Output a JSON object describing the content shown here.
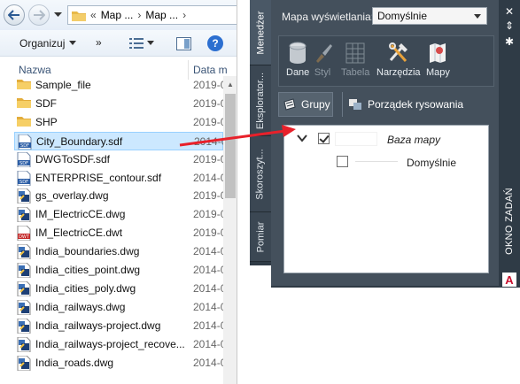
{
  "explorer": {
    "address": {
      "back_icon": "back-arrow-icon",
      "forward_icon": "forward-arrow-icon",
      "overflow": "«",
      "crumbs": [
        "Map ...",
        "Map ..."
      ],
      "crumb_separator": "›"
    },
    "toolbar": {
      "organize_label": "Organizuj",
      "more_label": "»",
      "help_label": "?"
    },
    "columns": {
      "name": "Nazwa",
      "date": "Data m"
    },
    "files": [
      {
        "name": "Sample_file",
        "date": "2019-0",
        "icon": "folder-icon"
      },
      {
        "name": "SDF",
        "date": "2019-0",
        "icon": "folder-icon"
      },
      {
        "name": "SHP",
        "date": "2019-0",
        "icon": "folder-icon"
      },
      {
        "name": "City_Boundary.sdf",
        "date": "2014-0",
        "icon": "sdf-file-icon",
        "selected": true
      },
      {
        "name": "DWGToSDF.sdf",
        "date": "2019-0",
        "icon": "sdf-file-icon"
      },
      {
        "name": "ENTERPRISE_contour.sdf",
        "date": "2014-0",
        "icon": "sdf-file-icon"
      },
      {
        "name": "gs_overlay.dwg",
        "date": "2019-0",
        "icon": "dwg-file-icon"
      },
      {
        "name": "IM_ElectricCE.dwg",
        "date": "2019-0",
        "icon": "dwg-file-icon"
      },
      {
        "name": "IM_ElectricCE.dwt",
        "date": "2019-0",
        "icon": "dwt-file-icon"
      },
      {
        "name": "India_boundaries.dwg",
        "date": "2014-0",
        "icon": "dwg-file-icon"
      },
      {
        "name": "India_cities_point.dwg",
        "date": "2014-0",
        "icon": "dwg-file-icon"
      },
      {
        "name": "India_cities_poly.dwg",
        "date": "2014-0",
        "icon": "dwg-file-icon"
      },
      {
        "name": "India_railways.dwg",
        "date": "2014-0",
        "icon": "dwg-file-icon"
      },
      {
        "name": "India_railways-project.dwg",
        "date": "2014-0",
        "icon": "dwg-file-icon"
      },
      {
        "name": "India_railways-project_recove...",
        "date": "2014-0",
        "icon": "dwg-file-icon"
      },
      {
        "name": "India_roads.dwg",
        "date": "2014-0",
        "icon": "dwg-file-icon"
      }
    ]
  },
  "palette": {
    "left_tabs": [
      "Menedżer",
      "Eksplorator...",
      "Skoroszyt...",
      "Pomiar"
    ],
    "map_label": "Mapa wyświetlania:",
    "map_value": "Domyślnie",
    "ribbon": [
      {
        "label": "Dane",
        "icon": "database-icon",
        "enabled": true
      },
      {
        "label": "Styl",
        "icon": "brush-icon",
        "enabled": false
      },
      {
        "label": "Tabela",
        "icon": "table-icon",
        "enabled": false
      },
      {
        "label": "Narzędzia",
        "icon": "tools-icon",
        "enabled": true
      },
      {
        "label": "Mapy",
        "icon": "maps-icon",
        "enabled": true
      }
    ],
    "groups_label": "Grupy",
    "draw_order_label": "Porządek rysowania",
    "tree": {
      "base_label": "Baza mapy",
      "base_checked": true,
      "layer_label": "Domyślnie",
      "layer_checked": false
    },
    "task_pane_label": "OKNO ZADAŃ",
    "logo_letter": "A",
    "colors": {
      "panel": "#44505c",
      "selected_row": "#cce8ff",
      "arrow": "#e8202a"
    }
  }
}
